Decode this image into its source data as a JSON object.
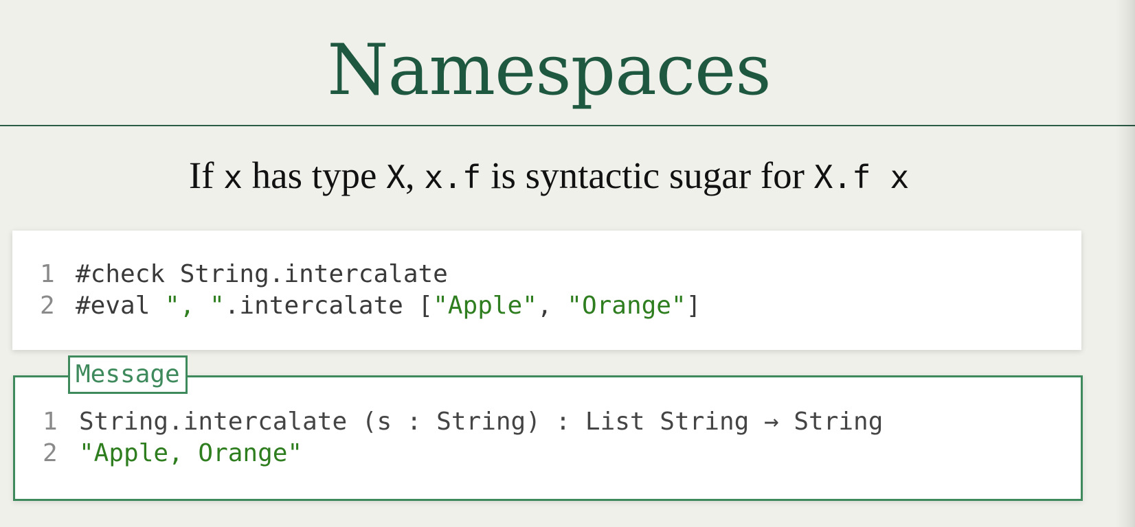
{
  "slide": {
    "title": "Namespaces",
    "subtitle": {
      "t1": "If ",
      "c1": "x",
      "t2": " has type ",
      "c2": "X",
      "t3": ", ",
      "c3": "x.f",
      "t4": " is syntactic sugar for ",
      "c4": "X.f x"
    }
  },
  "code": {
    "lines": [
      {
        "number": "1",
        "parts": [
          "#check String.intercalate"
        ]
      },
      {
        "number": "2",
        "parts": [
          "#eval ",
          "\", \"",
          ".intercalate [",
          "\"Apple\"",
          ", ",
          "\"Orange\"",
          "]"
        ]
      }
    ]
  },
  "message": {
    "label": "Message",
    "lines": [
      {
        "number": "1",
        "text": "String.intercalate (s : String) : List String → String"
      },
      {
        "number": "2",
        "text": "\"Apple, Orange\""
      }
    ]
  },
  "colors": {
    "title": "#1f5840",
    "string_literal": "#2e7d1f",
    "message_border": "#3e8a5c"
  }
}
